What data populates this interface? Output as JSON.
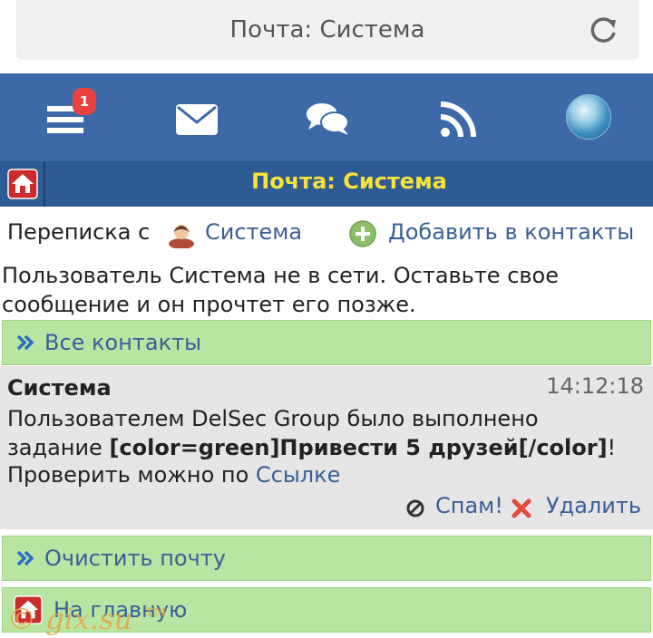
{
  "browser": {
    "title": "Почта: Система"
  },
  "nav": {
    "badge_count": "1",
    "badge_color": "#e8433f",
    "bar_color": "#3d69a9",
    "icons": [
      "menu-icon",
      "mail-icon",
      "chat-icon",
      "rss-icon",
      "avatar"
    ]
  },
  "header": {
    "title": "Почта: Система",
    "title_color": "#f7e23a"
  },
  "conversation": {
    "prefix": "Переписка с",
    "contact": "Система",
    "add_contact": "Добавить в контакты"
  },
  "offline_notice": {
    "line1": "Пользователь Система не в сети. Оставьте свое",
    "line2": "сообщение и он прочтет его позже."
  },
  "all_contacts": "Все контакты",
  "message": {
    "author": "Система",
    "time": "14:12:18",
    "line1": "Пользователем DelSec Group было выполнено",
    "line2_prefix": "задание ",
    "line2_bold": "[color=green]Привести 5 друзей[/color]",
    "line2_suffix": "!",
    "line3_prefix": "Проверить можно по ",
    "line3_link": "Ссылке",
    "spam": "Спам!",
    "delete": "Удалить"
  },
  "clear_mail": "Очистить почту",
  "home": "На главную",
  "watermark": "© gix.su ™"
}
